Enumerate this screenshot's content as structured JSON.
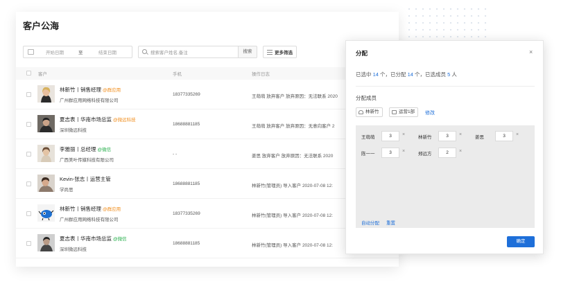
{
  "page": {
    "title": "客户公海",
    "filters": {
      "start_date_placeholder": "开始日期",
      "date_separator": "至",
      "end_date_placeholder": "结束日期",
      "search_placeholder": "搜索客户姓名,备注",
      "search_button": "搜索",
      "more_filters": "更多筛选"
    },
    "table": {
      "columns": {
        "customer": "客户",
        "phone": "手机",
        "log": "操作日志"
      },
      "rows": [
        {
          "name": "林新竹丨销售经理",
          "tag": "@群应用",
          "tag_color": "orange",
          "company": "广州群应用网络科技有限公司",
          "phone": "18377335269",
          "log": "王萌萌 放弃客户   放弃原因：无法联系   2020"
        },
        {
          "name": "夏志表丨华南市场总监",
          "tag": "@微远科技",
          "tag_color": "orange",
          "company": "深圳微远科技",
          "phone": "18688881185",
          "log": "王萌萌 放弃客户   放弃原因：无意向客户   2"
        },
        {
          "name": "李雅丽丨总经理",
          "tag": "@微信",
          "tag_color": "green",
          "company": "广西美叶传媒科技有限公司",
          "phone": "- -",
          "log": "姜思 放弃客户   放弃原因：无法联系   2020"
        },
        {
          "name": "Kevin-张志丨运营主管",
          "tag": "",
          "tag_color": "",
          "company": "学尚思",
          "phone": "18688881185",
          "log": "林新竹(管理员) 导入客户   2020-07-08 12:"
        },
        {
          "name": "林新竹丨销售经理",
          "tag": "@群应用",
          "tag_color": "orange",
          "company": "广州群应用网络科技有限公司",
          "phone": "18377335269",
          "log": "林新竹(管理员) 导入客户   2020-07-08 12:"
        },
        {
          "name": "夏志表丨华南市场总监",
          "tag": "@微信",
          "tag_color": "green",
          "company": "深圳微远科技",
          "phone": "18688881185",
          "log": "林新竹(管理员) 导入客户   2020-07-08 12:"
        }
      ]
    }
  },
  "panel": {
    "title": "分配",
    "close": "×",
    "summary": {
      "t1": "已选中 ",
      "selected": "14",
      "t2": " 个，已分配 ",
      "assigned": "14",
      "t3": " 个，已选成员 ",
      "members": "5",
      "t4": " 人"
    },
    "members_label": "分配成员",
    "chips": [
      "林新竹",
      "运营1部"
    ],
    "edit": "修改",
    "allocations": [
      {
        "name": "王萌萌",
        "qty": "3"
      },
      {
        "name": "林新竹",
        "qty": "3"
      },
      {
        "name": "姜思",
        "qty": "3"
      },
      {
        "name": "陈一一",
        "qty": "3"
      },
      {
        "name": "郑远方",
        "qty": "2"
      }
    ],
    "remove_symbol": "×",
    "auto_assign": "自动分配",
    "reset": "重置",
    "confirm": "确定"
  },
  "colors": {
    "accent": "#1e6fd9",
    "tag_orange": "#f08c1a",
    "tag_green": "#22ad48"
  }
}
